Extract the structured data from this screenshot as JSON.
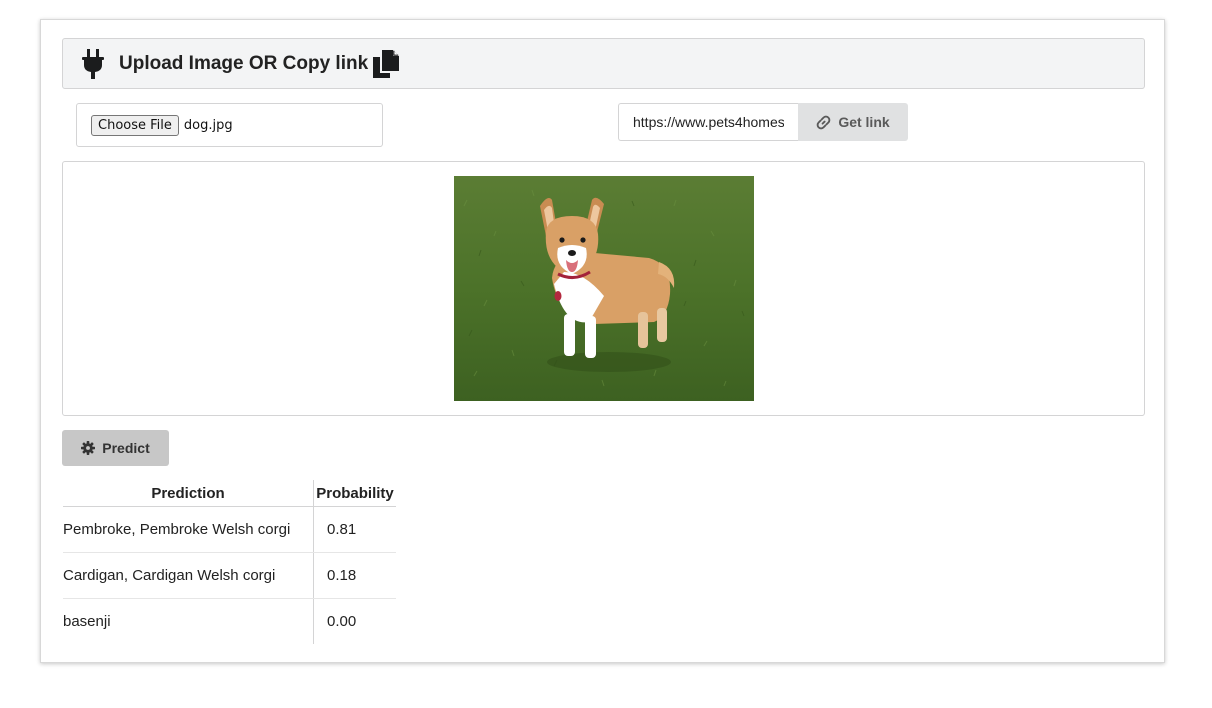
{
  "header": {
    "title": "Upload Image OR Copy link"
  },
  "upload": {
    "choose_label": "Choose File",
    "file_name": "dog.jpg"
  },
  "link": {
    "value": "https://www.pets4homes",
    "button_label": "Get link"
  },
  "image": {
    "alt": "corgi-on-grass-photo"
  },
  "predict": {
    "button_label": "Predict"
  },
  "results": {
    "headers": {
      "prediction": "Prediction",
      "probability": "Probability"
    },
    "rows": [
      {
        "label": "Pembroke, Pembroke Welsh corgi",
        "probability": "0.81"
      },
      {
        "label": "Cardigan, Cardigan Welsh corgi",
        "probability": "0.18"
      },
      {
        "label": "basenji",
        "probability": "0.00"
      }
    ]
  },
  "colors": {
    "header_bg": "#f3f4f5",
    "button_grey": "#e0e1e2",
    "predict_grey": "#c7c7c7",
    "border": "#d4d4d5"
  },
  "icons": {
    "header_left": "plug-icon",
    "header_right": "copy-icon",
    "link_button": "link-icon",
    "predict_button": "gear-icon"
  }
}
